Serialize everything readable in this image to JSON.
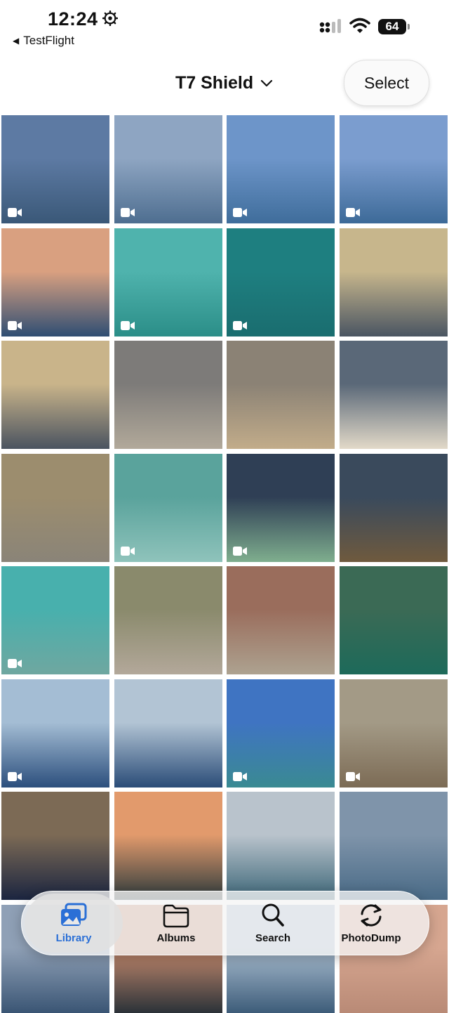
{
  "status_bar": {
    "time": "12:24",
    "back_app": "TestFlight",
    "battery": "64"
  },
  "nav": {
    "title": "T7 Shield",
    "select_label": "Select"
  },
  "grid": {
    "items": [
      {
        "type": "video",
        "top": "#5d7aa3",
        "bottom": "#3a5878"
      },
      {
        "type": "video",
        "top": "#8ea5c2",
        "bottom": "#4e6e90"
      },
      {
        "type": "video",
        "top": "#6d95c9",
        "bottom": "#3f6d9b"
      },
      {
        "type": "video",
        "top": "#7b9dcf",
        "bottom": "#3d6a98"
      },
      {
        "type": "video",
        "top": "#d9a080",
        "bottom": "#2f4e73"
      },
      {
        "type": "video",
        "top": "#4fb3ad",
        "bottom": "#2b8e88"
      },
      {
        "type": "video",
        "top": "#1e7f80",
        "bottom": "#1a6d6f"
      },
      {
        "type": "photo",
        "top": "#c7b68c",
        "bottom": "#4a5562"
      },
      {
        "type": "photo",
        "top": "#c9b48a",
        "bottom": "#4a5360"
      },
      {
        "type": "photo",
        "top": "#7d7b79",
        "bottom": "#b2a99a"
      },
      {
        "type": "photo",
        "top": "#8b8275",
        "bottom": "#c2ac8a"
      },
      {
        "type": "photo",
        "top": "#5a6878",
        "bottom": "#e2d9c8"
      },
      {
        "type": "photo",
        "top": "#9c8d6e",
        "bottom": "#8a8478"
      },
      {
        "type": "video",
        "top": "#5aa39c",
        "bottom": "#8fc3bb"
      },
      {
        "type": "video",
        "top": "#2f3f55",
        "bottom": "#7fae8e"
      },
      {
        "type": "photo",
        "top": "#3a4a5c",
        "bottom": "#6f5a3e"
      },
      {
        "type": "video",
        "top": "#48b0ad",
        "bottom": "#6fa7a0"
      },
      {
        "type": "photo",
        "top": "#8a8a6c",
        "bottom": "#b3a89a"
      },
      {
        "type": "photo",
        "top": "#9a6d5c",
        "bottom": "#ada290"
      },
      {
        "type": "photo",
        "top": "#3b6a55",
        "bottom": "#1d6a5a"
      },
      {
        "type": "video",
        "top": "#a4bdd4",
        "bottom": "#2c4f7d"
      },
      {
        "type": "photo",
        "top": "#b2c4d4",
        "bottom": "#2a4c78"
      },
      {
        "type": "video",
        "top": "#3f74c2",
        "bottom": "#3a8a92"
      },
      {
        "type": "video",
        "top": "#a39a86",
        "bottom": "#7c6b55"
      },
      {
        "type": "photo",
        "top": "#7c6a55",
        "bottom": "#1b2540"
      },
      {
        "type": "photo",
        "top": "#e29a6c",
        "bottom": "#2d3a3c"
      },
      {
        "type": "photo",
        "top": "#b9c3cc",
        "bottom": "#3d6678"
      },
      {
        "type": "photo",
        "top": "#7f94aa",
        "bottom": "#496a86"
      },
      {
        "type": "photo",
        "top": "#8fa0b6",
        "bottom": "#3a5574"
      },
      {
        "type": "photo",
        "top": "#c58a6e",
        "bottom": "#2b3238"
      },
      {
        "type": "photo",
        "top": "#a8bccf",
        "bottom": "#3d5c79"
      },
      {
        "type": "photo",
        "top": "#d6a690",
        "bottom": "#b98a76"
      }
    ]
  },
  "tabbar": {
    "active_color": "#2a6fd6",
    "tabs": [
      {
        "label": "Library",
        "icon": "photo-library-icon"
      },
      {
        "label": "Albums",
        "icon": "folder-icon"
      },
      {
        "label": "Search",
        "icon": "search-icon"
      },
      {
        "label": "PhotoDump",
        "icon": "sync-icon"
      }
    ]
  }
}
